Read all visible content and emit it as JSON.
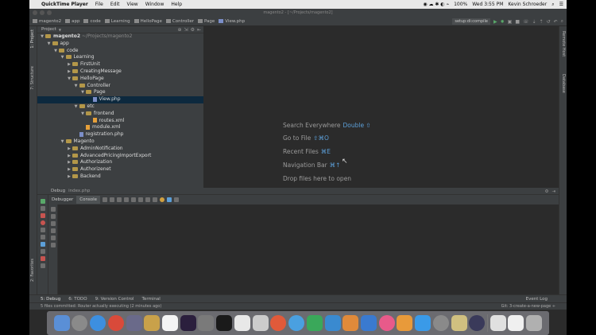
{
  "menubar": {
    "app": "QuickTime Player",
    "items": [
      "File",
      "Edit",
      "View",
      "Window",
      "Help"
    ],
    "battery": "100%",
    "clock": "Wed 3:55 PM",
    "user": "Kevin Schroeder"
  },
  "window_title": "magento2 - [~/Projects/magento2]",
  "breadcrumbs": [
    "magento2",
    "app",
    "code",
    "Learning",
    "HelloPage",
    "Controller",
    "Page",
    "View.php"
  ],
  "run_config": "setup:di:compile",
  "project_panel": {
    "title": "Project",
    "rows": [
      {
        "label": "magento2",
        "suffix": " ~/Projects/magento2",
        "depth": 0,
        "kind": "folder",
        "open": true
      },
      {
        "label": "app",
        "depth": 1,
        "kind": "folder",
        "open": true
      },
      {
        "label": "code",
        "depth": 2,
        "kind": "folder",
        "open": true
      },
      {
        "label": "Learning",
        "depth": 3,
        "kind": "folder",
        "open": true
      },
      {
        "label": "FirstUnit",
        "depth": 4,
        "kind": "folder",
        "open": false
      },
      {
        "label": "CreatingMessage",
        "depth": 4,
        "kind": "folder",
        "open": false
      },
      {
        "label": "HelloPage",
        "depth": 4,
        "kind": "folder",
        "open": true
      },
      {
        "label": "Controller",
        "depth": 5,
        "kind": "folder",
        "open": true
      },
      {
        "label": "Page",
        "depth": 6,
        "kind": "folder",
        "open": true
      },
      {
        "label": "View.php",
        "depth": 7,
        "kind": "php",
        "selected": true
      },
      {
        "label": "etc",
        "depth": 5,
        "kind": "folder",
        "open": true
      },
      {
        "label": "frontend",
        "depth": 6,
        "kind": "folder",
        "open": true
      },
      {
        "label": "routes.xml",
        "depth": 7,
        "kind": "xml"
      },
      {
        "label": "module.xml",
        "depth": 6,
        "kind": "xml"
      },
      {
        "label": "registration.php",
        "depth": 5,
        "kind": "php"
      },
      {
        "label": "Magento",
        "depth": 3,
        "kind": "folder",
        "open": true
      },
      {
        "label": "AdminNotification",
        "depth": 4,
        "kind": "folder",
        "open": false
      },
      {
        "label": "AdvancedPricingImportExport",
        "depth": 4,
        "kind": "folder",
        "open": false
      },
      {
        "label": "Authorization",
        "depth": 4,
        "kind": "folder",
        "open": false
      },
      {
        "label": "Authorizenet",
        "depth": 4,
        "kind": "folder",
        "open": false
      },
      {
        "label": "Backend",
        "depth": 4,
        "kind": "folder",
        "open": false
      }
    ]
  },
  "editor_hints": [
    {
      "text": "Search Everywhere",
      "key": "Double ⇧"
    },
    {
      "text": "Go to File",
      "key": "⇧⌘O"
    },
    {
      "text": "Recent Files",
      "key": "⌘E"
    },
    {
      "text": "Navigation Bar",
      "key": "⌘↑"
    },
    {
      "text": "Drop files here to open",
      "key": ""
    }
  ],
  "debug_panel": {
    "title": "Debug",
    "file": "index.php",
    "tabs": [
      "Debugger",
      "Console"
    ]
  },
  "left_tools": [
    "1: Project",
    "7: Structure",
    "2: Favorites"
  ],
  "right_tools": [
    "Remote Host",
    "Database"
  ],
  "bottom_tabs": [
    "5: Debug",
    "6: TODO",
    "9: Version Control",
    "Terminal"
  ],
  "event_log": "Event Log",
  "status_text": "5 files committed: Router actually executing (2 minutes ago)",
  "status_right": "Git: 3-create-a-new-page ÷",
  "colors": {
    "accent": "#5c9fd8",
    "selection": "#0d293e",
    "run": "#59a869"
  }
}
